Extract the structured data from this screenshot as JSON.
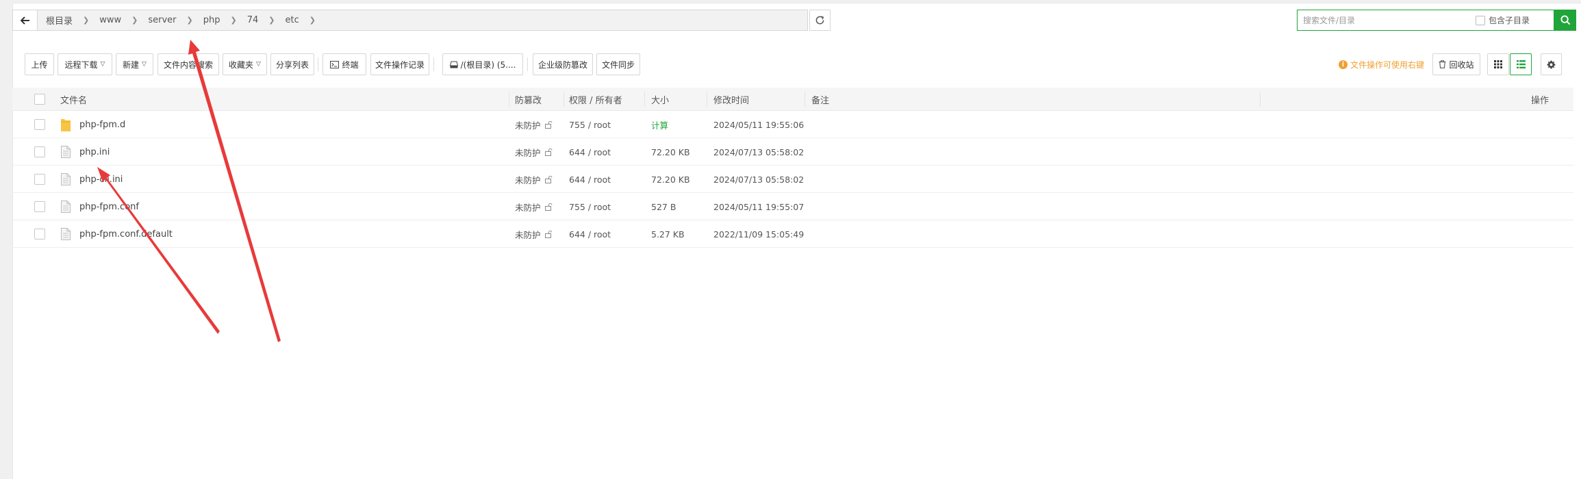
{
  "address": {
    "breadcrumbs": [
      "根目录",
      "www",
      "server",
      "php",
      "74",
      "etc"
    ]
  },
  "search": {
    "placeholder": "搜索文件/目录",
    "include_subdir_label": "包含子目录"
  },
  "toolbar": {
    "upload": "上传",
    "remote_download": "远程下载",
    "new": "新建",
    "content_search": "文件内容搜索",
    "favorites": "收藏夹",
    "share_list": "分享列表",
    "terminal": "终端",
    "operation_log": "文件操作记录",
    "disk": "/(根目录) (5....",
    "enterprise_tamper": "企业级防篡改",
    "file_sync": "文件同步"
  },
  "right_toolbar": {
    "tip": "文件操作可使用右键",
    "recycle_bin": "回收站"
  },
  "table": {
    "columns": {
      "name": "文件名",
      "tamper": "防篡改",
      "perm_owner": "权限 / 所有者",
      "size": "大小",
      "mtime": "修改时间",
      "remark": "备注",
      "action": "操作"
    },
    "rows": [
      {
        "name": "php-fpm.d",
        "type": "folder",
        "tamper": "未防护",
        "perm": "755 / root",
        "size": "计算",
        "mtime": "2024/05/11 19:55:06",
        "remark": ""
      },
      {
        "name": "php.ini",
        "type": "file",
        "tamper": "未防护",
        "perm": "644 / root",
        "size": "72.20 KB",
        "mtime": "2024/07/13 05:58:02",
        "remark": ""
      },
      {
        "name": "php-cli.ini",
        "type": "file",
        "tamper": "未防护",
        "perm": "644 / root",
        "size": "72.20 KB",
        "mtime": "2024/07/13 05:58:02",
        "remark": ""
      },
      {
        "name": "php-fpm.conf",
        "type": "file",
        "tamper": "未防护",
        "perm": "755 / root",
        "size": "527 B",
        "mtime": "2024/05/11 19:55:07",
        "remark": ""
      },
      {
        "name": "php-fpm.conf.default",
        "type": "file",
        "tamper": "未防护",
        "perm": "644 / root",
        "size": "5.27 KB",
        "mtime": "2022/11/09 15:05:49",
        "remark": ""
      }
    ]
  },
  "colors": {
    "accent": "#20a53a",
    "warning": "#f0a030",
    "annotation": "#e83a3a"
  },
  "icons": {
    "back": "arrow-left-icon",
    "refresh": "refresh-icon",
    "search": "search-icon",
    "terminal": "terminal-icon",
    "disk": "disk-icon",
    "recycle": "trash-icon",
    "grid_view": "grid-view-icon",
    "list_view": "list-view-icon",
    "settings": "gear-icon",
    "folder": "folder-icon",
    "file": "file-icon",
    "lock": "unlock-icon"
  }
}
